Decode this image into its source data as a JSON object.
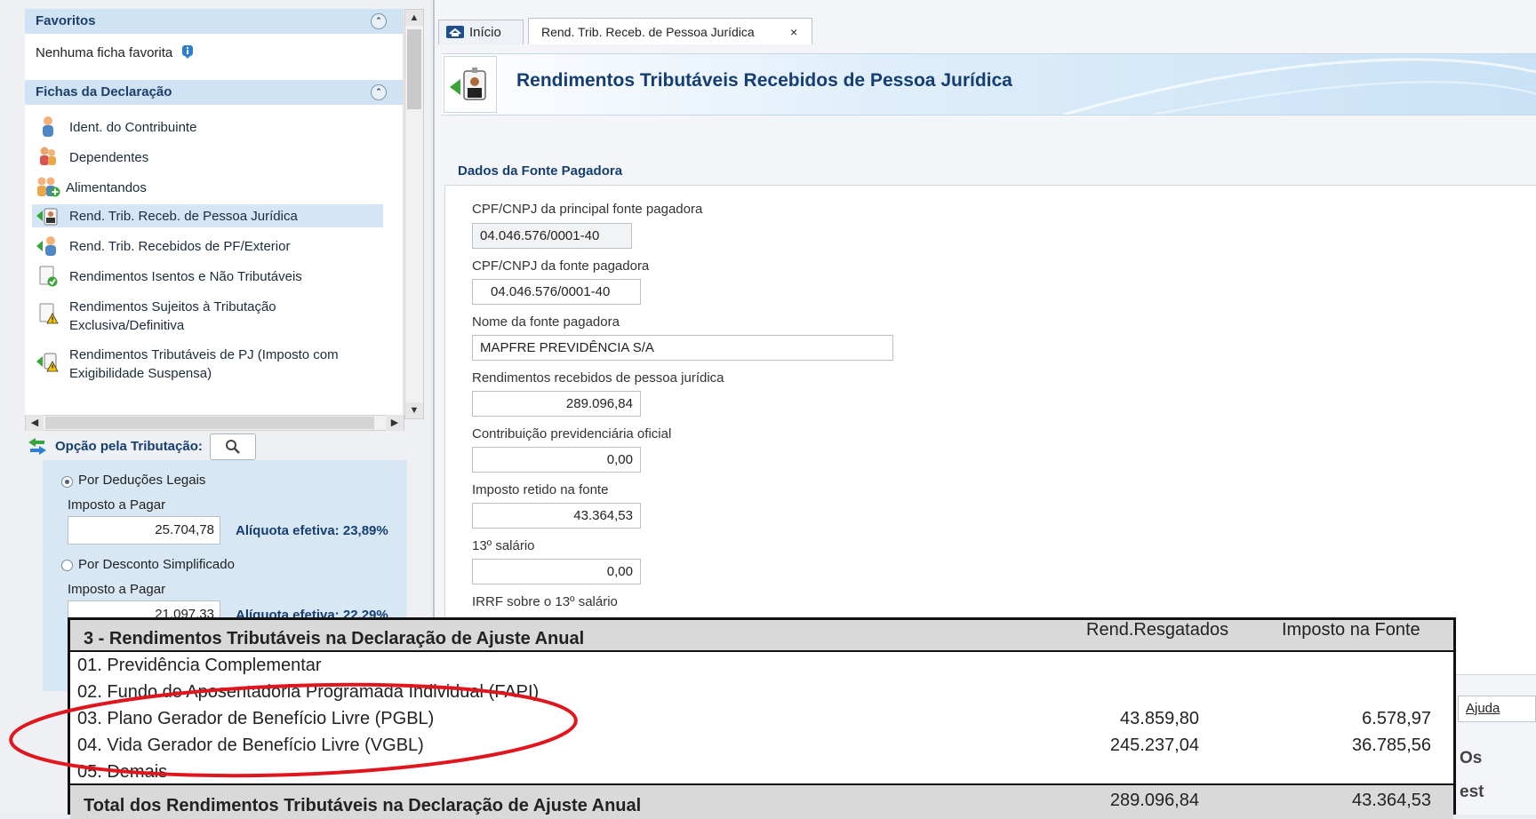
{
  "sidebar": {
    "favorites_title": "Favoritos",
    "favorites_empty": "Nenhuma ficha favorita",
    "fichas_title": "Fichas da Declaração",
    "items": [
      {
        "label": "Ident. do Contribuinte"
      },
      {
        "label": "Dependentes"
      },
      {
        "label": "Alimentandos"
      },
      {
        "label": "Rend. Trib. Receb. de Pessoa Jurídica"
      },
      {
        "label": "Rend. Trib. Recebidos de PF/Exterior"
      },
      {
        "label": "Rendimentos Isentos e Não Tributáveis"
      },
      {
        "label": "Rendimentos Sujeitos à Tributação Exclusiva/Definitiva"
      },
      {
        "label": "Rendimentos Tributáveis de PJ (Imposto com Exigibilidade Suspensa)"
      }
    ],
    "option_title": "Opção pela Tributação:",
    "deducoes": {
      "label": "Por Deduções Legais",
      "imposto_label": "Imposto a Pagar",
      "imposto_value": "25.704,78",
      "aliquota": "Alíquota efetiva: 23,89%"
    },
    "simplificado": {
      "label": "Por Desconto Simplificado",
      "imposto_label": "Imposto a Pagar",
      "imposto_value": "21.097,33",
      "aliquota": "Alíquota efetiva: 22,29%"
    }
  },
  "tabs": [
    {
      "label": "Início"
    },
    {
      "label": "Rend. Trib. Receb. de Pessoa Jurídica",
      "close": "×"
    }
  ],
  "banner": {
    "title": "Rendimentos Tributáveis Recebidos de Pessoa Jurídica"
  },
  "form": {
    "section_title": "Dados da Fonte Pagadora",
    "principal_cnpj_label": "CPF/CNPJ da principal fonte pagadora",
    "principal_cnpj_value": "04.046.576/0001-40",
    "cnpj_label": "CPF/CNPJ da fonte pagadora",
    "cnpj_value": "04.046.576/0001-40",
    "nome_label": "Nome da fonte pagadora",
    "nome_value": "MAPFRE PREVIDÊNCIA S/A",
    "rendimentos_label": "Rendimentos recebidos de pessoa jurídica",
    "rendimentos_value": "289.096,84",
    "contribuicao_label": "Contribuição previdenciária oficial",
    "contribuicao_value": "0,00",
    "imposto_label": "Imposto retido na fonte",
    "imposto_value": "43.364,53",
    "salario13_label": "13º salário",
    "salario13_value": "0,00",
    "irrf13_label": "IRRF sobre o 13º salário"
  },
  "help_label": "Ajuda",
  "side_text": [
    "Os",
    "est"
  ],
  "table": {
    "title": "3 - Rendimentos Tributáveis na Declaração de Ajuste Anual",
    "col1": "Rend.Resgatados",
    "col2": "Imposto na Fonte",
    "rows": [
      {
        "label": "01. Previdência Complementar",
        "v1": "",
        "v2": ""
      },
      {
        "label": "02. Fundo de Aposentadoria Programada Individual (FAPI)",
        "v1": "",
        "v2": ""
      },
      {
        "label": "03. Plano Gerador de Benefício Livre (PGBL)",
        "v1": "43.859,80",
        "v2": "6.578,97"
      },
      {
        "label": "04. Vida Gerador de Benefício Livre (VGBL)",
        "v1": "245.237,04",
        "v2": "36.785,56"
      },
      {
        "label": "05. Demais",
        "v1": "",
        "v2": ""
      }
    ],
    "total_label": "Total dos Rendimentos Tributáveis na Declaração de Ajuste Anual",
    "total_v1": "289.096,84",
    "total_v2": "43.364,53"
  },
  "colors": {
    "highlight": "#e0161e",
    "header_text": "#163e73",
    "panel": "#d8e7f4"
  }
}
